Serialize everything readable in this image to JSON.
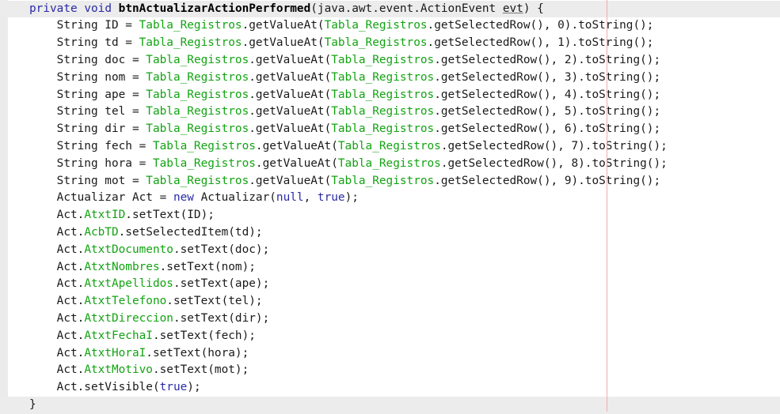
{
  "editor": {
    "lines": [
      {
        "highlight": true,
        "tokens": [
          {
            "t": "private",
            "c": "kw"
          },
          {
            "t": " "
          },
          {
            "t": "void",
            "c": "kw"
          },
          {
            "t": " "
          },
          {
            "t": "btnActualizarActionPerformed",
            "c": "fn"
          },
          {
            "t": "(java.awt.event.ActionEvent "
          },
          {
            "t": "evt",
            "c": "ul"
          },
          {
            "t": ") {"
          }
        ]
      },
      {
        "tokens": [
          {
            "t": "    String ID = "
          },
          {
            "t": "Tabla_Registros",
            "c": "fld"
          },
          {
            "t": ".getValueAt("
          },
          {
            "t": "Tabla_Registros",
            "c": "fld"
          },
          {
            "t": ".getSelectedRow(), 0).toString();"
          }
        ]
      },
      {
        "tokens": [
          {
            "t": "    String td = "
          },
          {
            "t": "Tabla_Registros",
            "c": "fld"
          },
          {
            "t": ".getValueAt("
          },
          {
            "t": "Tabla_Registros",
            "c": "fld"
          },
          {
            "t": ".getSelectedRow(), 1).toString();"
          }
        ]
      },
      {
        "tokens": [
          {
            "t": "    String doc = "
          },
          {
            "t": "Tabla_Registros",
            "c": "fld"
          },
          {
            "t": ".getValueAt("
          },
          {
            "t": "Tabla_Registros",
            "c": "fld"
          },
          {
            "t": ".getSelectedRow(), 2).toString();"
          }
        ]
      },
      {
        "tokens": [
          {
            "t": "    String nom = "
          },
          {
            "t": "Tabla_Registros",
            "c": "fld"
          },
          {
            "t": ".getValueAt("
          },
          {
            "t": "Tabla_Registros",
            "c": "fld"
          },
          {
            "t": ".getSelectedRow(), 3).toString();"
          }
        ]
      },
      {
        "tokens": [
          {
            "t": "    String ape = "
          },
          {
            "t": "Tabla_Registros",
            "c": "fld"
          },
          {
            "t": ".getValueAt("
          },
          {
            "t": "Tabla_Registros",
            "c": "fld"
          },
          {
            "t": ".getSelectedRow(), 4).toString();"
          }
        ]
      },
      {
        "tokens": [
          {
            "t": "    String tel = "
          },
          {
            "t": "Tabla_Registros",
            "c": "fld"
          },
          {
            "t": ".getValueAt("
          },
          {
            "t": "Tabla_Registros",
            "c": "fld"
          },
          {
            "t": ".getSelectedRow(), 5).toString();"
          }
        ]
      },
      {
        "tokens": [
          {
            "t": "    String dir = "
          },
          {
            "t": "Tabla_Registros",
            "c": "fld"
          },
          {
            "t": ".getValueAt("
          },
          {
            "t": "Tabla_Registros",
            "c": "fld"
          },
          {
            "t": ".getSelectedRow(), 6).toString();"
          }
        ]
      },
      {
        "tokens": [
          {
            "t": "    String fech = "
          },
          {
            "t": "Tabla_Registros",
            "c": "fld"
          },
          {
            "t": ".getValueAt("
          },
          {
            "t": "Tabla_Registros",
            "c": "fld"
          },
          {
            "t": ".getSelectedRow(), 7).toString();"
          }
        ]
      },
      {
        "tokens": [
          {
            "t": "    String hora = "
          },
          {
            "t": "Tabla_Registros",
            "c": "fld"
          },
          {
            "t": ".getValueAt("
          },
          {
            "t": "Tabla_Registros",
            "c": "fld"
          },
          {
            "t": ".getSelectedRow(), 8).toString();"
          }
        ]
      },
      {
        "tokens": [
          {
            "t": "    String mot = "
          },
          {
            "t": "Tabla_Registros",
            "c": "fld"
          },
          {
            "t": ".getValueAt("
          },
          {
            "t": "Tabla_Registros",
            "c": "fld"
          },
          {
            "t": ".getSelectedRow(), 9).toString();"
          }
        ]
      },
      {
        "tokens": [
          {
            "t": "    Actualizar Act = "
          },
          {
            "t": "new",
            "c": "kw"
          },
          {
            "t": " Actualizar("
          },
          {
            "t": "null",
            "c": "kw"
          },
          {
            "t": ", "
          },
          {
            "t": "true",
            "c": "kw"
          },
          {
            "t": ");"
          }
        ]
      },
      {
        "tokens": [
          {
            "t": "    Act."
          },
          {
            "t": "AtxtID",
            "c": "fld"
          },
          {
            "t": ".setText(ID);"
          }
        ]
      },
      {
        "tokens": [
          {
            "t": "    Act."
          },
          {
            "t": "AcbTD",
            "c": "fld"
          },
          {
            "t": ".setSelectedItem(td);"
          }
        ]
      },
      {
        "tokens": [
          {
            "t": "    Act."
          },
          {
            "t": "AtxtDocumento",
            "c": "fld"
          },
          {
            "t": ".setText(doc);"
          }
        ]
      },
      {
        "tokens": [
          {
            "t": "    Act."
          },
          {
            "t": "AtxtNombres",
            "c": "fld"
          },
          {
            "t": ".setText(nom);"
          }
        ]
      },
      {
        "tokens": [
          {
            "t": "    Act."
          },
          {
            "t": "AtxtApellidos",
            "c": "fld"
          },
          {
            "t": ".setText(ape);"
          }
        ]
      },
      {
        "tokens": [
          {
            "t": "    Act."
          },
          {
            "t": "AtxtTelefono",
            "c": "fld"
          },
          {
            "t": ".setText(tel);"
          }
        ]
      },
      {
        "tokens": [
          {
            "t": "    Act."
          },
          {
            "t": "AtxtDireccion",
            "c": "fld"
          },
          {
            "t": ".setText(dir);"
          }
        ]
      },
      {
        "tokens": [
          {
            "t": "    Act."
          },
          {
            "t": "AtxtFechaI",
            "c": "fld"
          },
          {
            "t": ".setText(fech);"
          }
        ]
      },
      {
        "tokens": [
          {
            "t": "    Act."
          },
          {
            "t": "AtxtHoraI",
            "c": "fld"
          },
          {
            "t": ".setText(hora);"
          }
        ]
      },
      {
        "tokens": [
          {
            "t": "    Act."
          },
          {
            "t": "AtxtMotivo",
            "c": "fld"
          },
          {
            "t": ".setText(mot);"
          }
        ]
      },
      {
        "tokens": [
          {
            "t": "    Act.setVisible("
          },
          {
            "t": "true",
            "c": "kw"
          },
          {
            "t": ");"
          }
        ]
      },
      {
        "highlight": true,
        "tokens": [
          {
            "t": "}"
          }
        ]
      }
    ]
  },
  "colors": {
    "keyword": "#2a2aa6",
    "field": "#13a313",
    "text": "#1a1a1a",
    "line_highlight": "#ececec",
    "margin_line": "#f2aaaa"
  }
}
